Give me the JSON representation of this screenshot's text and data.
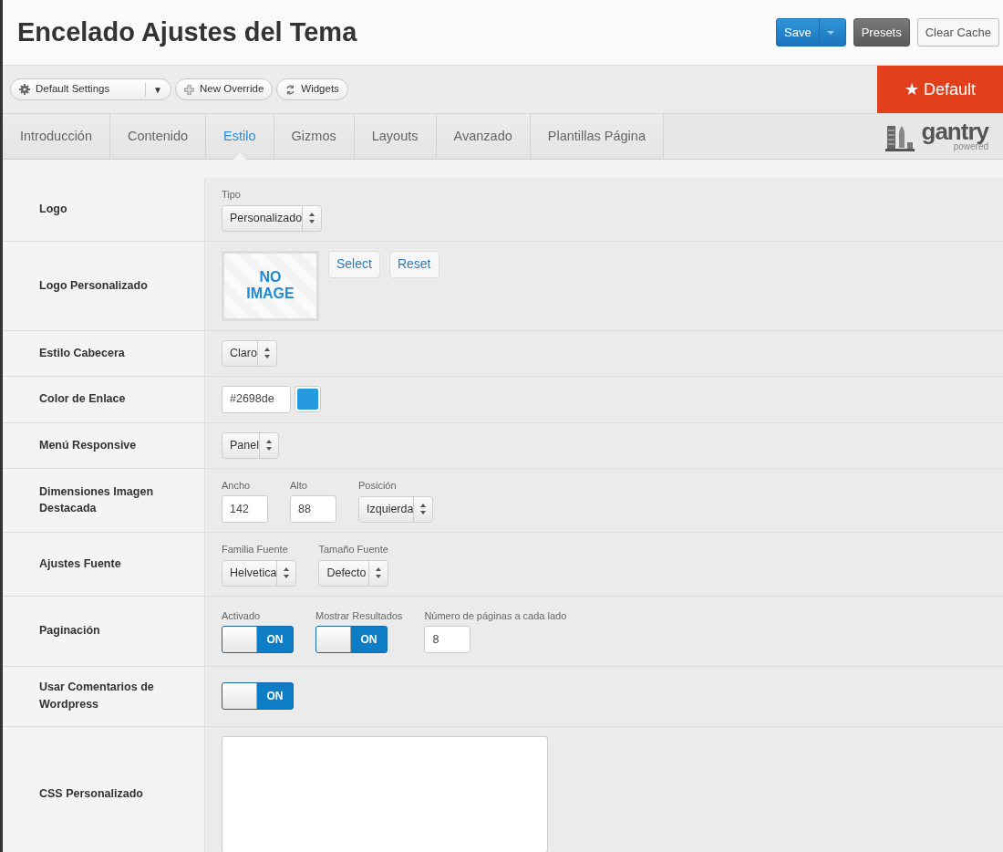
{
  "page_title": "Encelado Ajustes del Tema",
  "header_buttons": [
    {
      "kind": "split",
      "label": "Save"
    },
    {
      "kind": "dark",
      "label": "Presets"
    },
    {
      "kind": "light",
      "label": "Clear Cache"
    }
  ],
  "toolbar": {
    "settings_dropdown": "Default Settings",
    "dropdown_caret": "▼",
    "buttons": [
      {
        "kind": "plus",
        "label": "New Override"
      },
      {
        "kind": "cycle",
        "label": "Widgets"
      }
    ],
    "badge": "★ Default"
  },
  "tabs": [
    {
      "label": "Introducción",
      "selected": false
    },
    {
      "label": "Contenido",
      "selected": false
    },
    {
      "label": "Estilo",
      "selected": true
    },
    {
      "label": "Gizmos",
      "selected": false
    },
    {
      "label": "Layouts",
      "selected": false
    },
    {
      "label": "Avanzado",
      "selected": false
    },
    {
      "label": "Plantillas Página",
      "selected": false
    }
  ],
  "brand": {
    "name": "gantry",
    "tagline": "powered"
  },
  "rows": [
    {
      "label": "Logo",
      "controls": [
        {
          "kind": "select",
          "caption": "Tipo",
          "value": "Personalizado"
        }
      ]
    },
    {
      "label": "Logo Personalizado",
      "controls": [
        {
          "kind": "image",
          "text": "NO IMAGE"
        },
        {
          "kind": "button",
          "label": "Select"
        },
        {
          "kind": "button",
          "label": "Reset"
        }
      ]
    },
    {
      "label": "Estilo Cabecera",
      "controls": [
        {
          "kind": "select",
          "value": "Claro"
        }
      ]
    },
    {
      "label": "Color de Enlace",
      "controls": [
        {
          "kind": "color",
          "value": "#2698de",
          "color": "#2698de"
        }
      ]
    },
    {
      "label": "Menú Responsive",
      "controls": [
        {
          "kind": "select",
          "value": "Panel"
        }
      ]
    },
    {
      "label": "Dimensiones Imagen Destacada",
      "controls": [
        {
          "kind": "text",
          "caption": "Ancho",
          "value": "142"
        },
        {
          "kind": "text",
          "caption": "Alto",
          "value": "88"
        },
        {
          "kind": "select",
          "caption": "Posición",
          "value": "Izquierda"
        }
      ]
    },
    {
      "label": "Ajustes Fuente",
      "controls": [
        {
          "kind": "select",
          "caption": "Familia Fuente",
          "value": "Helvetica"
        },
        {
          "kind": "select",
          "caption": "Tamaño Fuente",
          "value": "Defecto"
        }
      ]
    },
    {
      "label": "Paginación",
      "controls": [
        {
          "kind": "toggle",
          "caption": "Activado",
          "label": "ON",
          "on": true
        },
        {
          "kind": "toggle",
          "caption": "Mostrar Resultados",
          "label": "ON",
          "on": true
        },
        {
          "kind": "text",
          "caption": "Número de páginas a cada lado",
          "value": "8"
        }
      ]
    },
    {
      "label": "Usar Comentarios de Wordpress",
      "controls": [
        {
          "kind": "toggle",
          "label": "ON",
          "on": true
        }
      ]
    },
    {
      "label": "CSS Personalizado",
      "controls": [
        {
          "kind": "textarea"
        }
      ]
    }
  ]
}
